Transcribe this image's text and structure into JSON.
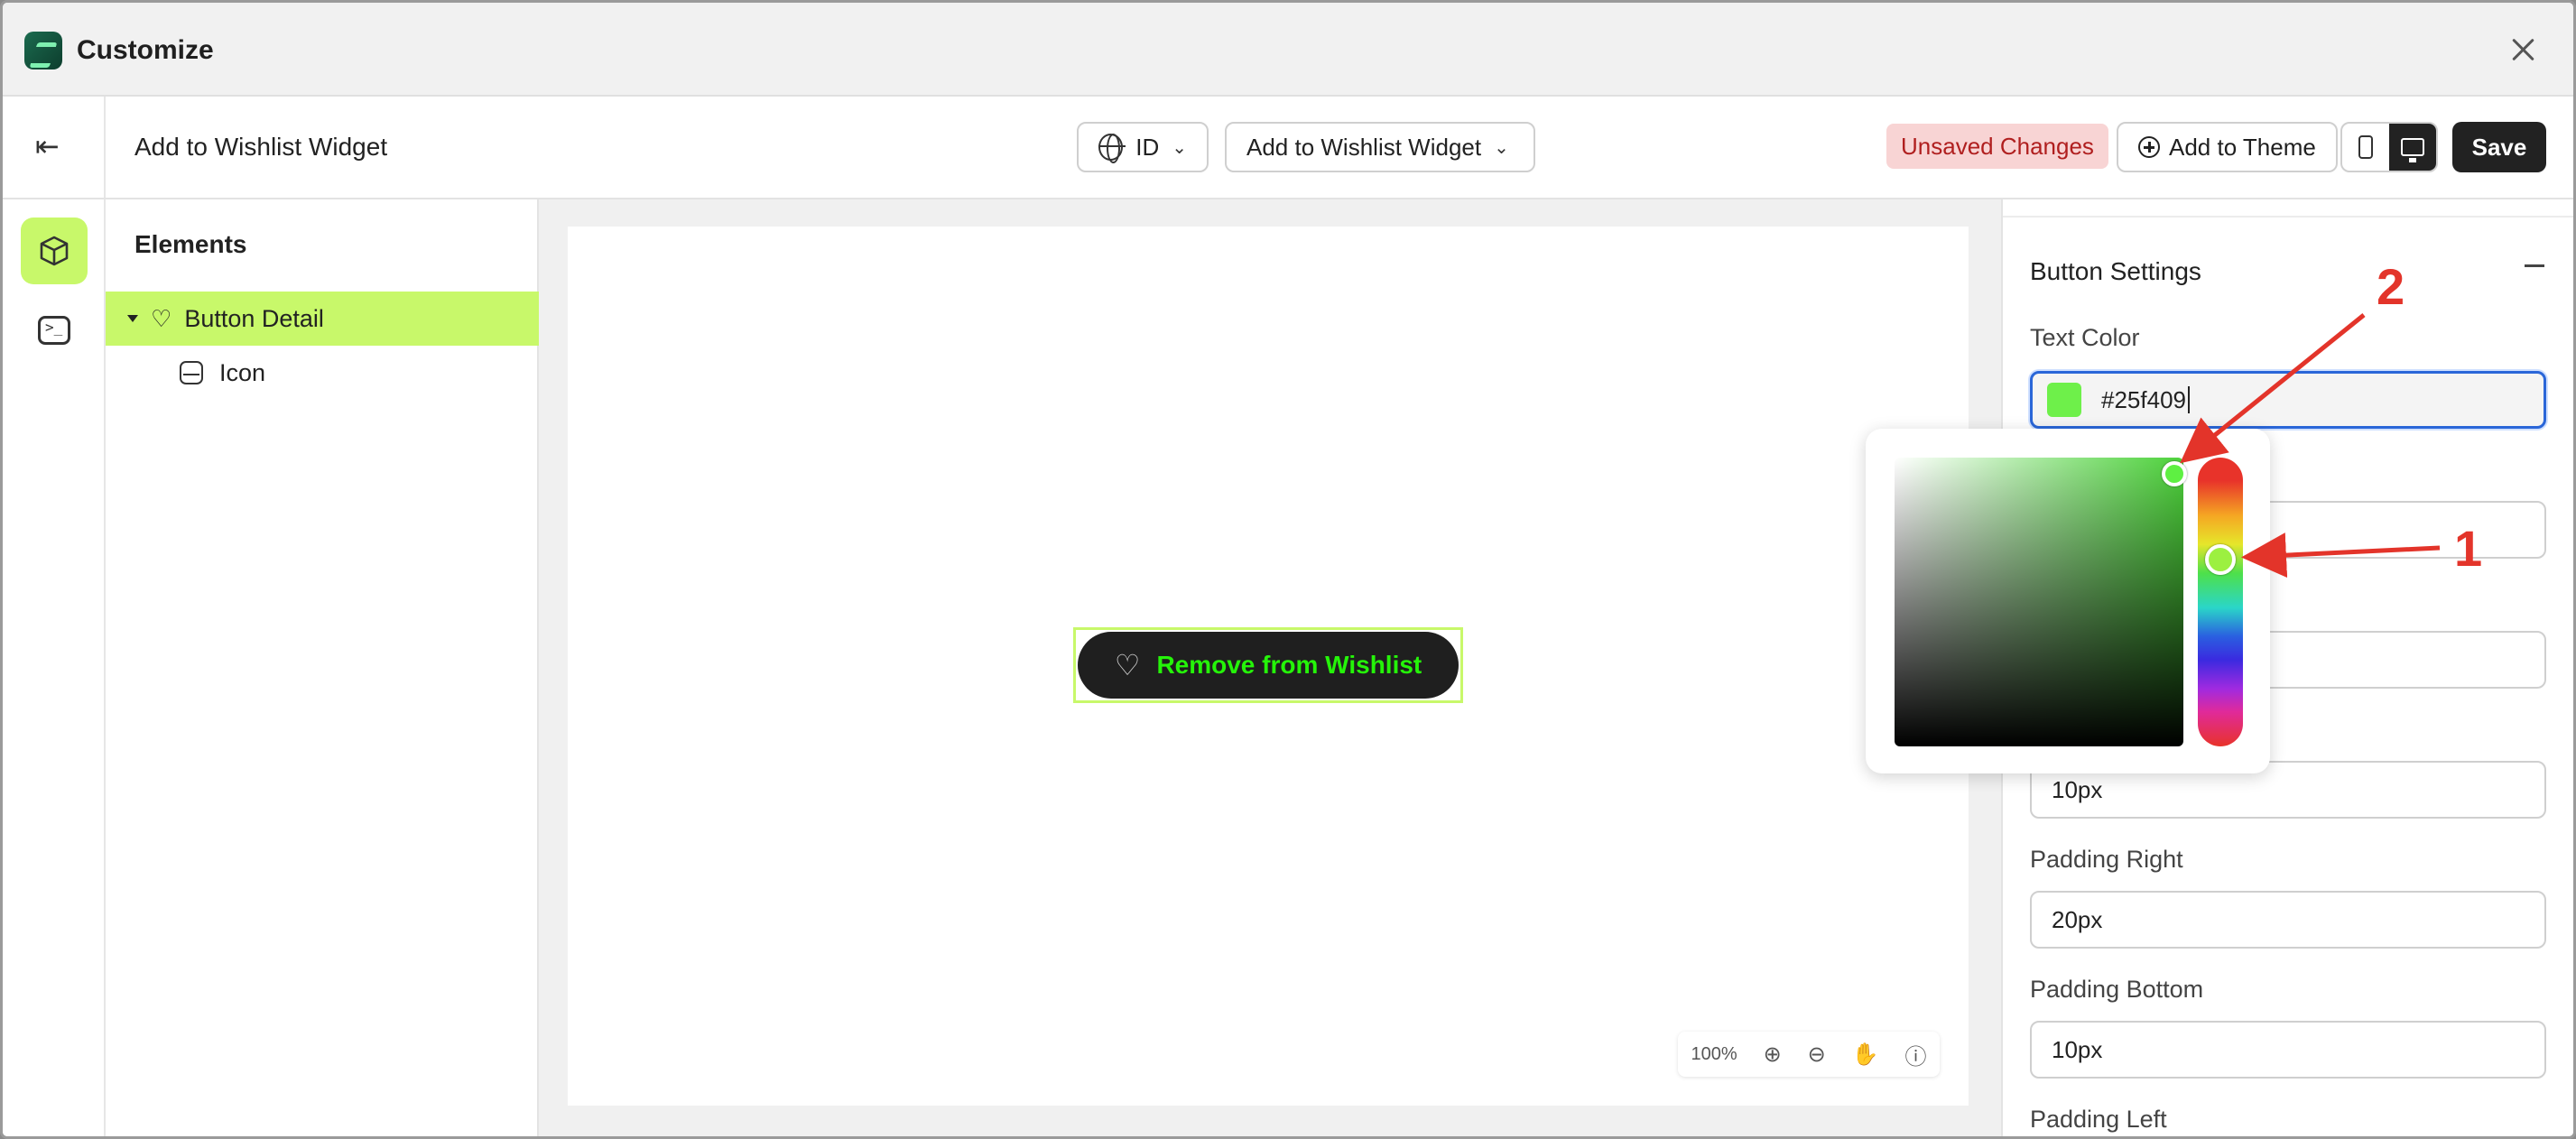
{
  "window": {
    "title": "Customize"
  },
  "topbar": {
    "page_name": "Add to Wishlist Widget",
    "language": "ID",
    "template": "Add to Wishlist Widget",
    "unsaved_badge": "Unsaved Changes",
    "add_to_theme": "Add to Theme",
    "save": "Save",
    "device_active": "desktop"
  },
  "elements_panel": {
    "title": "Elements",
    "items": [
      {
        "label": "Button Detail",
        "active": true,
        "icon": "heart-icon"
      },
      {
        "label": "Icon",
        "active": false,
        "icon": "icon-element-icon"
      }
    ]
  },
  "canvas": {
    "button_label": "Remove from Wishlist",
    "button_text_color": "#25f409",
    "zoom": "100%"
  },
  "settings": {
    "section_title": "Button Settings",
    "text_color_label": "Text Color",
    "text_color_value": "#25f409",
    "fields": [
      {
        "label": "Padding Right",
        "value": "20px"
      },
      {
        "label": "Padding Bottom",
        "value": "10px"
      },
      {
        "label": "Padding Left",
        "value": ""
      }
    ],
    "padding_top_value": "10px"
  },
  "color_picker": {
    "selected_color": "#25f409"
  },
  "annotations": {
    "marker_1": "1",
    "marker_2": "2",
    "color": "#e3342a"
  }
}
